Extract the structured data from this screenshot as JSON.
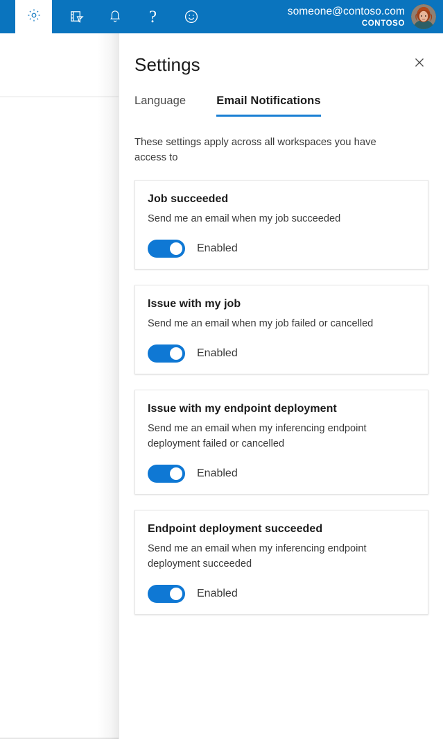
{
  "topbar": {
    "background_color": "#0a74be",
    "settings_tab_label": "settings-gear",
    "icons": [
      {
        "name": "feedback-directory-icon",
        "label": "Directory"
      },
      {
        "name": "bell-icon",
        "label": "Notifications"
      },
      {
        "name": "help-icon",
        "label": "?"
      },
      {
        "name": "smiley-icon",
        "label": "Feedback"
      }
    ],
    "account": {
      "email": "someone@contoso.com",
      "organization": "CONTOSO",
      "avatar_alt": "user-avatar"
    }
  },
  "panel": {
    "title": "Settings",
    "close_label": "close-icon",
    "accent_color": "#1a7fd4",
    "tabs": [
      {
        "label": "Language",
        "active": false
      },
      {
        "label": "Email Notifications",
        "active": true
      }
    ],
    "description": "These settings apply across all workspaces you have access to",
    "cards": [
      {
        "title": "Job succeeded",
        "description": "Send me an email when my job succeeded",
        "toggle_state": "on",
        "toggle_label": "Enabled"
      },
      {
        "title": "Issue with my job",
        "description": "Send me an email when my job failed or cancelled",
        "toggle_state": "on",
        "toggle_label": "Enabled"
      },
      {
        "title": "Issue with my endpoint deployment",
        "description": "Send me an email when my inferencing endpoint deployment failed or cancelled",
        "toggle_state": "on",
        "toggle_label": "Enabled"
      },
      {
        "title": "Endpoint deployment succeeded",
        "description": "Send me an email when my inferencing endpoint deployment succeeded",
        "toggle_state": "on",
        "toggle_label": "Enabled"
      }
    ]
  }
}
